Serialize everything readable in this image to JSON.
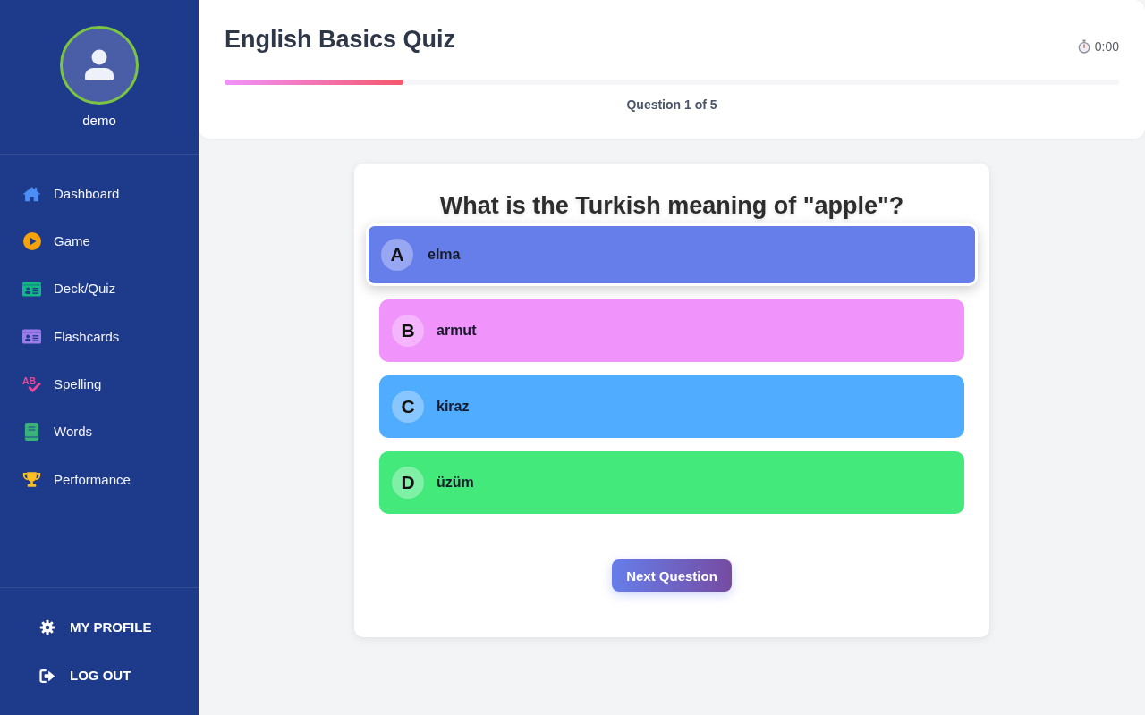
{
  "sidebar": {
    "user": {
      "name": "demo"
    },
    "nav_items": [
      {
        "label": "Dashboard"
      },
      {
        "label": "Game"
      },
      {
        "label": "Deck/Quiz"
      },
      {
        "label": "Flashcards"
      },
      {
        "label": "Spelling",
        "icon_text": "AB"
      },
      {
        "label": "Words"
      },
      {
        "label": "Performance"
      }
    ],
    "footer_items": [
      {
        "label": "MY PROFILE"
      },
      {
        "label": "LOG OUT"
      }
    ]
  },
  "header": {
    "title": "English Basics Quiz",
    "timer": "0:00",
    "progress": {
      "level": 0.2
    },
    "question_counter": "Question 1 of 5"
  },
  "quiz": {
    "question": "What is the Turkish meaning of \"apple\"?",
    "options": [
      {
        "letter": "A",
        "text": "elma",
        "color": "#667eea",
        "selected": true
      },
      {
        "letter": "B",
        "text": "armut",
        "color": "#f093fb",
        "selected": false
      },
      {
        "letter": "C",
        "text": "kiraz",
        "color": "#4facfe",
        "selected": false
      },
      {
        "letter": "D",
        "text": "üzüm",
        "color": "#43e97b",
        "selected": false
      }
    ],
    "next_button": "Next Question"
  }
}
